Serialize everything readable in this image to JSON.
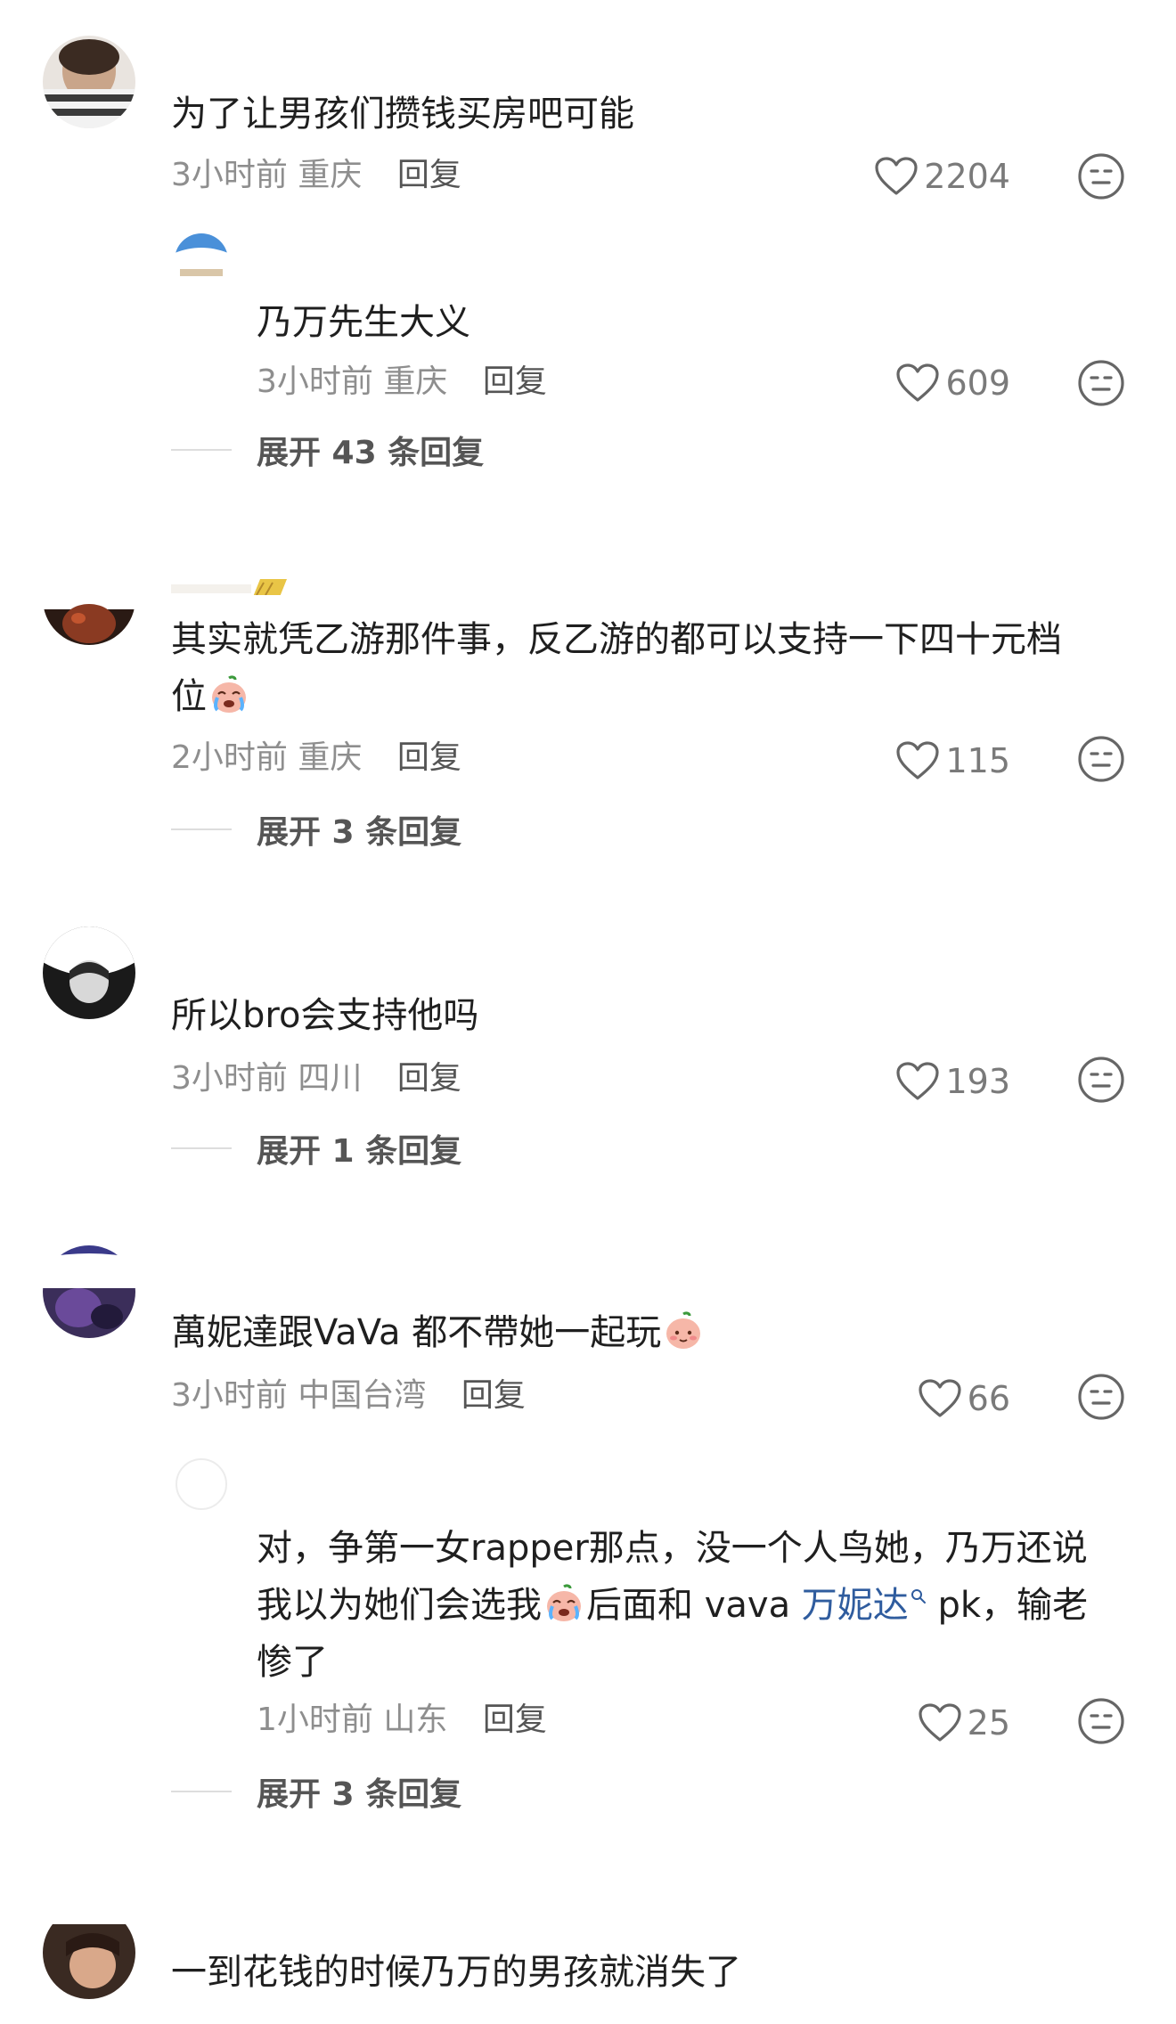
{
  "colors": {
    "text": "#1f1f1f",
    "meta": "#8e8e8e",
    "reply_action": "#555555",
    "mention": "#2f5c9e",
    "icon": "#666666"
  },
  "icons": {
    "like": "heart-outline-icon",
    "dislike": "neutral-face-icon",
    "emoji_cry": "crying-face-emoji",
    "emoji_blush": "peach-face-emoji"
  },
  "comments": [
    {
      "text": "为了让男孩们攒钱买房吧可能",
      "time": "3小时前",
      "location": "重庆",
      "reply_label": "回复",
      "likes": "2204",
      "replies": [
        {
          "text": "乃万先生大义",
          "time": "3小时前",
          "location": "重庆",
          "reply_label": "回复",
          "likes": "609"
        }
      ],
      "expand_label": "展开 43 条回复"
    },
    {
      "text_parts": [
        "其实就凭乙游那件事，反乙游的都可以支持一下四十元档",
        "位"
      ],
      "time": "2小时前",
      "location": "重庆",
      "reply_label": "回复",
      "likes": "115",
      "expand_label": "展开 3 条回复"
    },
    {
      "text": "所以bro会支持他吗",
      "time": "3小时前",
      "location": "四川",
      "reply_label": "回复",
      "likes": "193",
      "expand_label": "展开 1 条回复"
    },
    {
      "text": "萬妮達跟VaVa 都不帶她一起玩",
      "time": "3小时前",
      "location": "中国台湾",
      "reply_label": "回复",
      "likes": "66",
      "replies": [
        {
          "text_line1": "对，争第一女rapper那点，没一个人鸟她，乃万还说",
          "text_line2a": "我以为她们会选我",
          "text_line2b": "后面和 vava ",
          "mention": "万妮达",
          "text_line2c": " pk，输老",
          "text_line3": "惨了",
          "time": "1小时前",
          "location": "山东",
          "reply_label": "回复",
          "likes": "25"
        }
      ],
      "expand_label": "展开 3 条回复"
    },
    {
      "text": "一到花钱的时候乃万的男孩就消失了"
    }
  ]
}
